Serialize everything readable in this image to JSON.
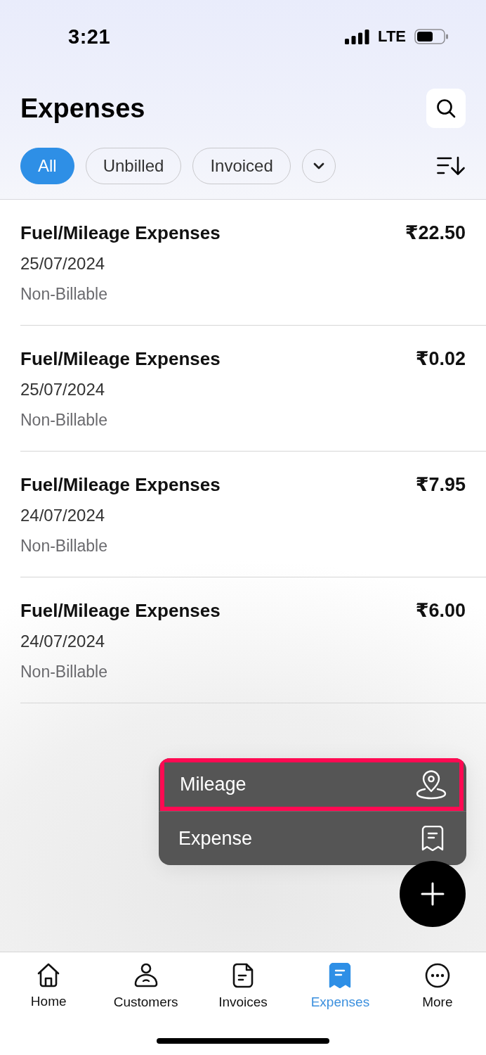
{
  "status_bar": {
    "time": "3:21",
    "network": "LTE"
  },
  "header": {
    "title": "Expenses"
  },
  "filters": [
    {
      "label": "All",
      "selected": true
    },
    {
      "label": "Unbilled",
      "selected": false
    },
    {
      "label": "Invoiced",
      "selected": false
    }
  ],
  "expenses": [
    {
      "name": "Fuel/Mileage Expenses",
      "amount": "₹22.50",
      "date": "25/07/2024",
      "billing": "Non-Billable"
    },
    {
      "name": "Fuel/Mileage Expenses",
      "amount": "₹0.02",
      "date": "25/07/2024",
      "billing": "Non-Billable"
    },
    {
      "name": "Fuel/Mileage Expenses",
      "amount": "₹7.95",
      "date": "24/07/2024",
      "billing": "Non-Billable"
    },
    {
      "name": "Fuel/Mileage Expenses",
      "amount": "₹6.00",
      "date": "24/07/2024",
      "billing": "Non-Billable"
    }
  ],
  "add_menu": {
    "items": [
      {
        "label": "Mileage",
        "kind": "mileage",
        "highlighted": true
      },
      {
        "label": "Expense",
        "kind": "expense",
        "highlighted": false
      }
    ]
  },
  "tab_bar": [
    {
      "label": "Home",
      "kind": "home",
      "selected": false
    },
    {
      "label": "Customers",
      "kind": "customers",
      "selected": false
    },
    {
      "label": "Invoices",
      "kind": "invoices",
      "selected": false
    },
    {
      "label": "Expenses",
      "kind": "expenses",
      "selected": true
    },
    {
      "label": "More",
      "kind": "more",
      "selected": false
    }
  ]
}
